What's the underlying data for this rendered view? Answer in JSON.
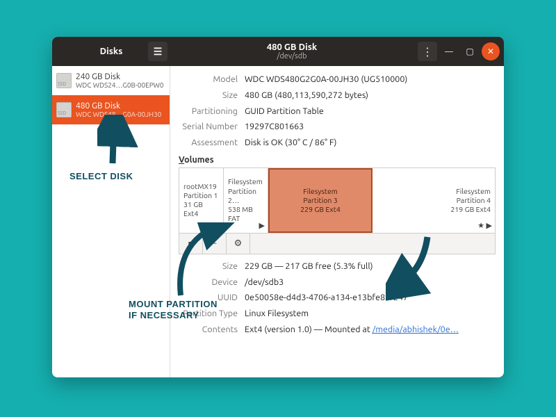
{
  "titlebar": {
    "left_label": "Disks",
    "main_title": "480 GB Disk",
    "subtitle": "/dev/sdb"
  },
  "sidebar": {
    "items": [
      {
        "name": "240 GB Disk",
        "model": "WDC WDS24…G0B-00EPW0"
      },
      {
        "name": "480 GB Disk",
        "model": "WDC WDS48…G0A-00JH30"
      }
    ]
  },
  "details": {
    "model_label": "Model",
    "model_value": "WDC WDS480G2G0A-00JH30 (UG510000)",
    "size_label": "Size",
    "size_value": "480 GB (480,113,590,272 bytes)",
    "partitioning_label": "Partitioning",
    "partitioning_value": "GUID Partition Table",
    "serial_label": "Serial Number",
    "serial_value": "19297C801663",
    "assessment_label": "Assessment",
    "assessment_value": "Disk is OK (30° C / 86° F)"
  },
  "volumes_label": "Volumes",
  "volumes": [
    {
      "name": "rootMX19",
      "part": "Partition 1",
      "size": "31 GB Ext4"
    },
    {
      "name": "Filesystem",
      "part": "Partition 2…",
      "size": "538 MB FAT"
    },
    {
      "name": "Filesystem",
      "part": "Partition 3",
      "size": "229 GB Ext4"
    },
    {
      "name": "Filesystem",
      "part": "Partition 4",
      "size": "219 GB Ext4"
    }
  ],
  "partition": {
    "size_label": "Size",
    "size_value": "229 GB — 217 GB free (5.3% full)",
    "device_label": "Device",
    "device_value": "/dev/sdb3",
    "uuid_label": "UUID",
    "uuid_value": "0e50058e-d4d3-4706-a134-e13bfe81f247",
    "type_label": "Partition Type",
    "type_value": "Linux Filesystem",
    "contents_label": "Contents",
    "contents_prefix": "Ext4 (version 1.0) — Mounted at ",
    "contents_link": "/media/abhishek/0e…"
  },
  "annotations": {
    "select_disk": "SELECT DISK",
    "mount_partition": "MOUNT PARTITION\nIF NECESSARY"
  }
}
